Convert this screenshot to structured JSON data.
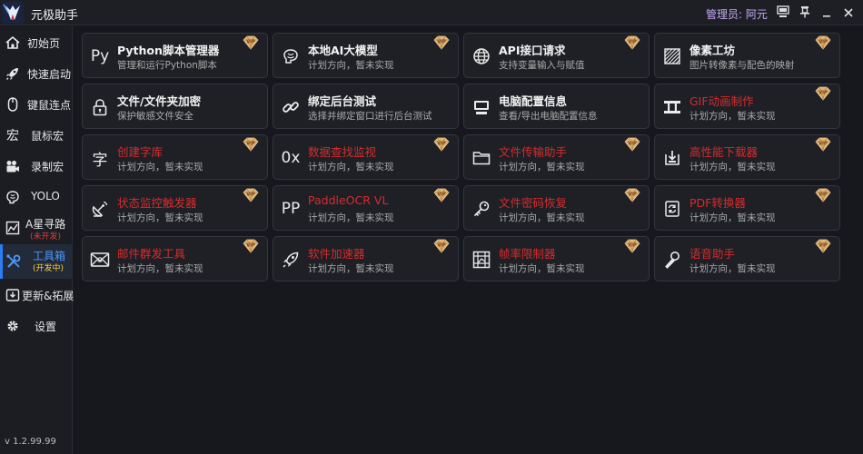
{
  "app": {
    "title": "元极助手",
    "admin_prefix": "管理员: ",
    "admin_name": "阿元",
    "version": "v 1.2.99.99"
  },
  "sidebar": {
    "items": [
      {
        "label": "初始页",
        "icon": "home-icon"
      },
      {
        "label": "快速启动",
        "icon": "rocket-icon"
      },
      {
        "label": "键鼠连点",
        "icon": "mouse-icon"
      },
      {
        "label": "鼠标宏",
        "icon": "macro-char-icon",
        "glyph": "宏"
      },
      {
        "label": "录制宏",
        "icon": "camera-icon"
      },
      {
        "label": "YOLO",
        "icon": "brain-icon"
      },
      {
        "label": "A星寻路",
        "sub": "(未开发)",
        "icon": "map-icon"
      },
      {
        "label": "工具箱",
        "sub": "(开发中)",
        "icon": "tools-icon"
      },
      {
        "label": "更新&拓展",
        "icon": "update-icon"
      },
      {
        "label": "设置",
        "icon": "gear-icon"
      }
    ]
  },
  "tools": [
    {
      "title": "Python脚本管理器",
      "sub": "管理和运行Python脚本",
      "icon": "python-icon",
      "glyph": "Py",
      "dev": false
    },
    {
      "title": "本地AI大模型",
      "sub": "计划方向，暂未实现",
      "icon": "brain-icon",
      "dev": false
    },
    {
      "title": "API接口请求",
      "sub": "支持变量输入与赋值",
      "icon": "globe-icon",
      "dev": false
    },
    {
      "title": "像素工坊",
      "sub": "图片转像素与配色的映射",
      "icon": "pixel-pattern-icon",
      "dev": false
    },
    {
      "title": "文件/文件夹加密",
      "sub": "保护敏感文件安全",
      "icon": "lock-icon",
      "dev": false
    },
    {
      "title": "绑定后台测试",
      "sub": "选择并绑定窗口进行后台测试",
      "icon": "link-icon",
      "dev": false
    },
    {
      "title": "电脑配置信息",
      "sub": "查看/导出电脑配置信息",
      "icon": "computer-icon",
      "dev": false
    },
    {
      "title": "GIF动画制作",
      "sub": "计划方向，暂未实现",
      "icon": "film-icon",
      "dev": true
    },
    {
      "title": "创建字库",
      "sub": "计划方向，暂未实现",
      "icon": "font-char-icon",
      "glyph": "字",
      "dev": true
    },
    {
      "title": "数据查找监视",
      "sub": "计划方向，暂未实现",
      "icon": "hex-icon",
      "glyph": "0x",
      "dev": true
    },
    {
      "title": "文件传输助手",
      "sub": "计划方向，暂未实现",
      "icon": "folder-icon",
      "dev": true
    },
    {
      "title": "高性能下载器",
      "sub": "计划方向，暂未实现",
      "icon": "download-icon",
      "dev": true
    },
    {
      "title": "状态监控触发器",
      "sub": "计划方向，暂未实现",
      "icon": "satellite-icon",
      "dev": true
    },
    {
      "title": "PaddleOCR VL",
      "sub": "计划方向，暂未实现",
      "icon": "pp-icon",
      "glyph": "PP",
      "dev": true
    },
    {
      "title": "文件密码恢复",
      "sub": "计划方向，暂未实现",
      "icon": "key-icon",
      "dev": true
    },
    {
      "title": "PDF转换器",
      "sub": "计划方向，暂未实现",
      "icon": "convert-icon",
      "dev": true
    },
    {
      "title": "邮件群发工具",
      "sub": "计划方向，暂未实现",
      "icon": "mail-icon",
      "dev": true
    },
    {
      "title": "软件加速器",
      "sub": "计划方向，暂未实现",
      "icon": "rocket-icon",
      "dev": true
    },
    {
      "title": "帧率限制器",
      "sub": "计划方向，暂未实现",
      "icon": "grid-frame-icon",
      "dev": true
    },
    {
      "title": "语音助手",
      "sub": "计划方向，暂未实现",
      "icon": "microphone-icon",
      "dev": true
    }
  ],
  "colors": {
    "background": "#16181d",
    "card": "#1e2026",
    "active_accent": "#2d7cf6",
    "dev_red": "#d62c2c",
    "vip_gold": "#e0b070",
    "admin_purple": "#c7a9f5"
  }
}
